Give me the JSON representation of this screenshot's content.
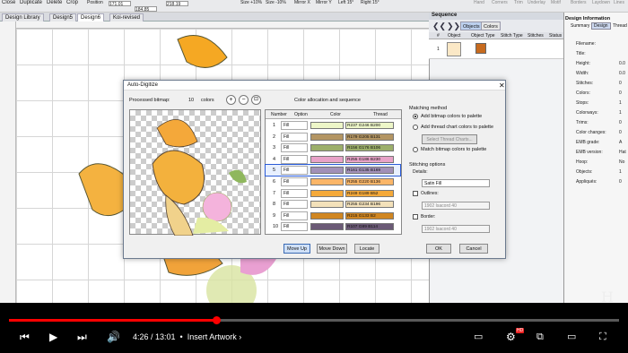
{
  "app": {
    "top_menu": [
      "Close",
      "Duplicate",
      "Delete",
      "Crop",
      "Position",
      "Size",
      "Mirror X",
      "Mirror Y",
      "Left 15°",
      "Right 15°",
      "Hand",
      "Corners",
      "Trim",
      "Underlay",
      "Motif",
      "Borders",
      "Laydown",
      "Lines"
    ],
    "toolbar": {
      "position_label": "Position",
      "pos_x": "171.01",
      "pos_y": "218.19",
      "size_label": "Size",
      "size_w": "184.85",
      "size_h": "100.0",
      "size_plus": "Size +10%",
      "size_minus": "Size -10%",
      "mirror_x": "Mirror X",
      "mirror_y": "Mirror Y",
      "left": "Left 15°",
      "right": "Right 15°"
    }
  },
  "tabs": [
    "Design Library",
    "Design5",
    "Design6",
    "Koi-revised"
  ],
  "active_tab": "Design6",
  "sequence": {
    "title": "Sequence",
    "tab_objects": "Objects",
    "tab_colors": "Colors",
    "columns": [
      "#",
      "Object",
      "Object Type",
      "Stitch Type",
      "Stitches",
      "Status"
    ],
    "row_num": "1"
  },
  "design_info": {
    "title": "Design Information",
    "tabs": [
      "Summary",
      "Design",
      "Thread"
    ],
    "fields": [
      {
        "label": "Filename:",
        "value": ""
      },
      {
        "label": "Title:",
        "value": ""
      },
      {
        "label": "Height:",
        "value": "0.0"
      },
      {
        "label": "Width:",
        "value": "0.0"
      },
      {
        "label": "Stitches:",
        "value": "0"
      },
      {
        "label": "Colors:",
        "value": "0"
      },
      {
        "label": "Stops:",
        "value": "1"
      },
      {
        "label": "Colorways:",
        "value": "1"
      },
      {
        "label": "Trims:",
        "value": "0"
      },
      {
        "label": "Color changes:",
        "value": "0"
      },
      {
        "label": "EMB grade:",
        "value": "A"
      },
      {
        "label": "EMB version:",
        "value": "Hat"
      },
      {
        "label": "Hoop:",
        "value": "No"
      },
      {
        "label": "Objects:",
        "value": "1"
      },
      {
        "label": "Appliqués:",
        "value": "0"
      }
    ]
  },
  "dialog": {
    "title": "Auto-Digitize",
    "processed_label": "Processed bitmap:",
    "color_count": "10",
    "colors_word": "colors",
    "allocation_title": "Color allocation and sequence",
    "columns": [
      "Number",
      "Option",
      "Color",
      "Thread"
    ],
    "rows": [
      {
        "num": "1",
        "option": "Fill",
        "color": "#edf6c8",
        "thread": "R237 G246 B200"
      },
      {
        "num": "2",
        "option": "Fill",
        "color": "#b39563",
        "thread": "R179 G205 B131"
      },
      {
        "num": "3",
        "option": "Fill",
        "color": "#9caf6a",
        "thread": "R156 G176 B106"
      },
      {
        "num": "4",
        "option": "Fill",
        "color": "#e8a2c8",
        "thread": "R255 G186 B230"
      },
      {
        "num": "5",
        "option": "Fill",
        "color": "#a190b8",
        "thread": "R161 G135 B169"
      },
      {
        "num": "6",
        "option": "Fill",
        "color": "#fbb668",
        "thread": "R255 G220 B136"
      },
      {
        "num": "7",
        "option": "Fill",
        "color": "#f4a93a",
        "thread": "R249 G189 B52"
      },
      {
        "num": "8",
        "option": "Fill",
        "color": "#f3e1ba",
        "thread": "R255 G234 B196"
      },
      {
        "num": "9",
        "option": "Fill",
        "color": "#d08621",
        "thread": "R215 G133 B2"
      },
      {
        "num": "10",
        "option": "Fill",
        "color": "#6b5a76",
        "thread": "R107 G89 B114"
      }
    ],
    "selected_row": "5",
    "matching": {
      "title": "Matching method",
      "opt1": "Add bitmap colors to palette",
      "opt2": "Add thread chart colors to palette",
      "select_chart": "Select Thread Charts...",
      "opt3": "Match bitmap colors to palette"
    },
    "stitching": {
      "title": "Stitching options",
      "details": "Details:",
      "stitch_type": "Satin Fill",
      "outlines": "Outlines:",
      "outlines_thread": "1902 Isacord 40",
      "border": "Border:",
      "border_thread": "1902 Isacord 40"
    },
    "buttons": {
      "move_up": "Move Up",
      "move_down": "Move Down",
      "locate": "Locate",
      "ok": "OK",
      "cancel": "Cancel"
    }
  },
  "player": {
    "time": "4:26 / 13:01",
    "chapter": "Insert Artwork",
    "progress": 0.34,
    "hd_badge": "HD"
  }
}
